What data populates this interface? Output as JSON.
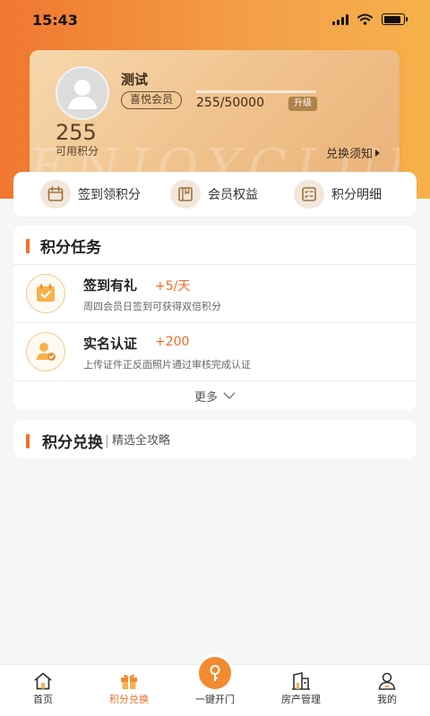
{
  "status_bar": {
    "time": "15:43",
    "icons": [
      "signal-icon",
      "wifi-icon",
      "battery-icon"
    ]
  },
  "colors": {
    "accent": "#f07028",
    "header_gradient_start": "#f0772f",
    "header_gradient_end": "#f6b14b",
    "card_gold": "#f0c18b",
    "reward_text": "#f06b22"
  },
  "member_card": {
    "watermark": "ENJOYCLUB",
    "user_name": "测试",
    "level": "喜悦会员",
    "progress_text": "255/50000",
    "progress_fraction": 0.0051,
    "upgrade_label": "升级",
    "points_value": "255",
    "points_label": "可用积分",
    "notice_label": "兑换须知"
  },
  "quick_actions": [
    {
      "label": "签到领积分",
      "icon": "calendar-icon"
    },
    {
      "label": "会员权益",
      "icon": "book-icon"
    },
    {
      "label": "积分明细",
      "icon": "checklist-icon"
    }
  ],
  "tasks_section": {
    "title": "积分任务",
    "tasks": [
      {
        "name": "签到有礼",
        "reward": "+5/天",
        "desc": "周四会员日签到可获得双倍积分",
        "icon": "calendar-check-icon"
      },
      {
        "name": "实名认证",
        "reward": "+200",
        "desc": "上传证件正反面照片通过审核完成认证",
        "icon": "user-verified-icon"
      }
    ],
    "more_label": "更多"
  },
  "exchange_section": {
    "title": "积分兑换",
    "subtitle": "精选全攻略"
  },
  "tabbar": {
    "tabs": [
      {
        "label": "首页",
        "icon": "home-icon",
        "active": false
      },
      {
        "label": "积分兑换",
        "icon": "gift-icon",
        "active": true
      },
      {
        "label": "一键开门",
        "icon": "key-icon",
        "active": false
      },
      {
        "label": "房产管理",
        "icon": "building-icon",
        "active": false
      },
      {
        "label": "我的",
        "icon": "profile-icon",
        "active": false
      }
    ]
  }
}
